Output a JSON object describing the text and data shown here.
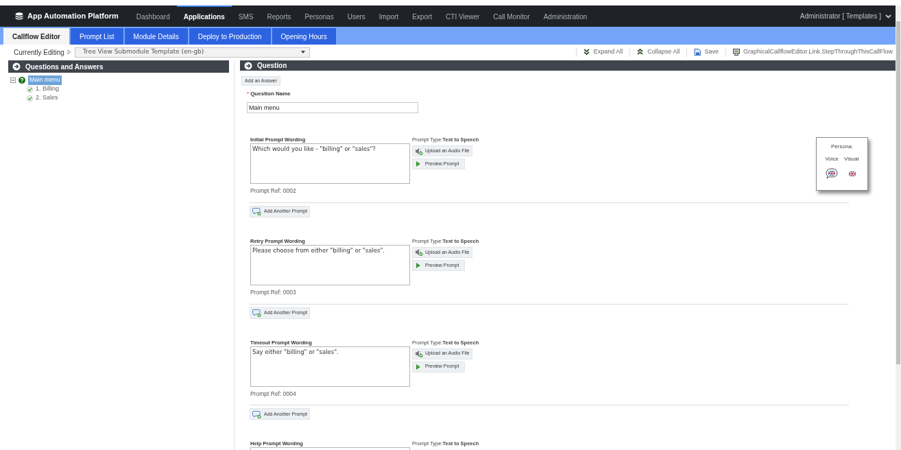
{
  "nav": {
    "brand": "App Automation Platform",
    "items": [
      {
        "label": "Dashboard",
        "selected": false
      },
      {
        "label": "Applications",
        "selected": true
      },
      {
        "label": "SMS",
        "selected": false
      },
      {
        "label": "Reports",
        "selected": false
      },
      {
        "label": "Personas",
        "selected": false
      },
      {
        "label": "Users",
        "selected": false
      },
      {
        "label": "Import",
        "selected": false
      },
      {
        "label": "Export",
        "selected": false
      },
      {
        "label": "CTI Viewer",
        "selected": false
      },
      {
        "label": "Call Monitor",
        "selected": false
      },
      {
        "label": "Administration",
        "selected": false
      }
    ],
    "user": "Administrator [ Templates ]"
  },
  "tabs": [
    {
      "label": "Callflow Editor",
      "selected": true
    },
    {
      "label": "Prompt List",
      "selected": false
    },
    {
      "label": "Module Details",
      "selected": false
    },
    {
      "label": "Deploy to Production",
      "selected": false
    },
    {
      "label": "Opening Hours",
      "selected": false
    }
  ],
  "toolbar": {
    "editing_label": "Currently Editing",
    "template": "Tree View Submodule Template (en-gb)",
    "actions": [
      {
        "kind": "expand",
        "label": "Expand All"
      },
      {
        "kind": "collapse",
        "label": "Collapse All"
      },
      {
        "kind": "save",
        "label": "Save"
      },
      {
        "kind": "step",
        "label": "GraphicalCallflowEditor.Link.StepThroughThisCallFlow"
      }
    ]
  },
  "tree_panel": {
    "title": "Questions and Answers",
    "root": {
      "label": "Main menu",
      "selected": true,
      "expanded": true,
      "children": [
        {
          "label": "1. Billing",
          "checked": true
        },
        {
          "label": "2. Sales",
          "checked": true
        }
      ]
    }
  },
  "question_panel": {
    "title": "Question",
    "add_answer": "Add an Answer",
    "required_mark": "*",
    "name_label": "Question Name",
    "name_value": "Main menu",
    "prompts": [
      {
        "label": "Initial Prompt Wording",
        "type_label": "Prompt Type:",
        "type": "Text to Speech",
        "text": "Which would you like - \"billing\" or \"sales\"?",
        "upload": "Upload an Audio File",
        "preview": "Preview Prompt",
        "ref": "Prompt Ref: 0002",
        "add_another": "Add Another Prompt"
      },
      {
        "label": "Retry Prompt Wording",
        "type_label": "Prompt Type:",
        "type": "Text to Speech",
        "text": "Please choose from either \"billing\" or \"sales\".",
        "upload": "Upload an Audio File",
        "preview": "Preview Prompt",
        "ref": "Prompt Ref: 0003",
        "add_another": "Add Another Prompt"
      },
      {
        "label": "Timeout Prompt Wording",
        "type_label": "Prompt Type:",
        "type": "Text to Speech",
        "text": "Say either \"billing\" or \"sales\".",
        "upload": "Upload an Audio File",
        "preview": "Preview Prompt",
        "ref": "Prompt Ref: 0004",
        "add_another": "Add Another Prompt"
      },
      {
        "label": "Help Prompt Wording",
        "type_label": "Prompt Type:",
        "type": "Text to Speech"
      }
    ]
  },
  "persona": {
    "title": "Persona:",
    "columns": [
      "Voice",
      "Visual"
    ]
  }
}
